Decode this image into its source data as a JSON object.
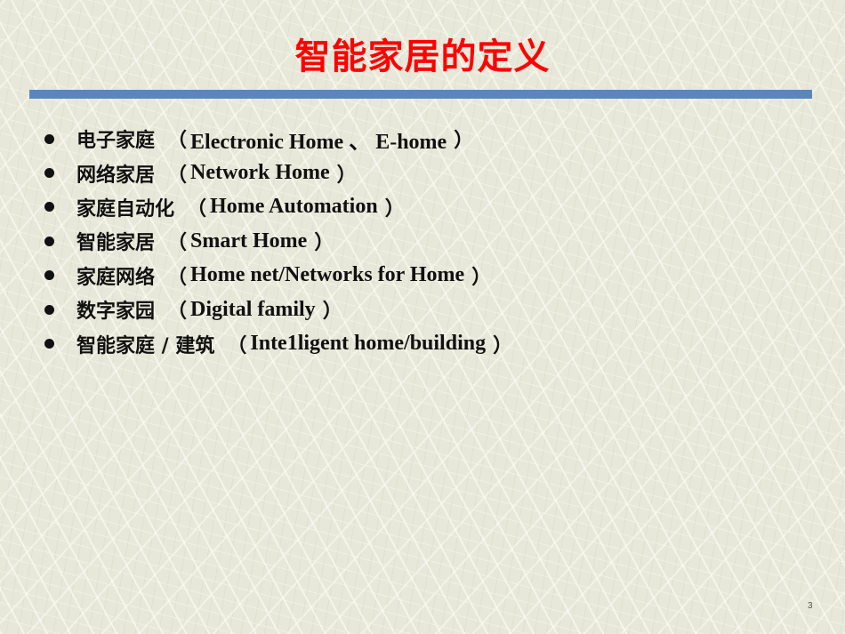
{
  "slide": {
    "title": "智能家居的定义",
    "title_color": "#ff0000",
    "bar_color": "#5a87bb",
    "page_number": "3",
    "bullets": [
      {
        "zh": "电子家庭",
        "open": "（",
        "en": "Electronic Home 、 E-home",
        "close": "）"
      },
      {
        "zh": "网络家居",
        "open": "（",
        "en": "Network Home",
        "close": "）"
      },
      {
        "zh": "家庭自动化",
        "open": "（",
        "en": "Home Automation",
        "close": "）"
      },
      {
        "zh": "智能家居",
        "open": "（",
        "en": "Smart Home",
        "close": "）"
      },
      {
        "zh": "家庭网络",
        "open": "（",
        "en": "Home net/Networks for Home",
        "close": "）"
      },
      {
        "zh": "数字家园",
        "open": "（",
        "en": "Digital family",
        "close": "）"
      },
      {
        "zh": "智能家庭 / 建筑",
        "open": "（",
        "en": "Inte1ligent home/building",
        "close": "）"
      }
    ]
  }
}
